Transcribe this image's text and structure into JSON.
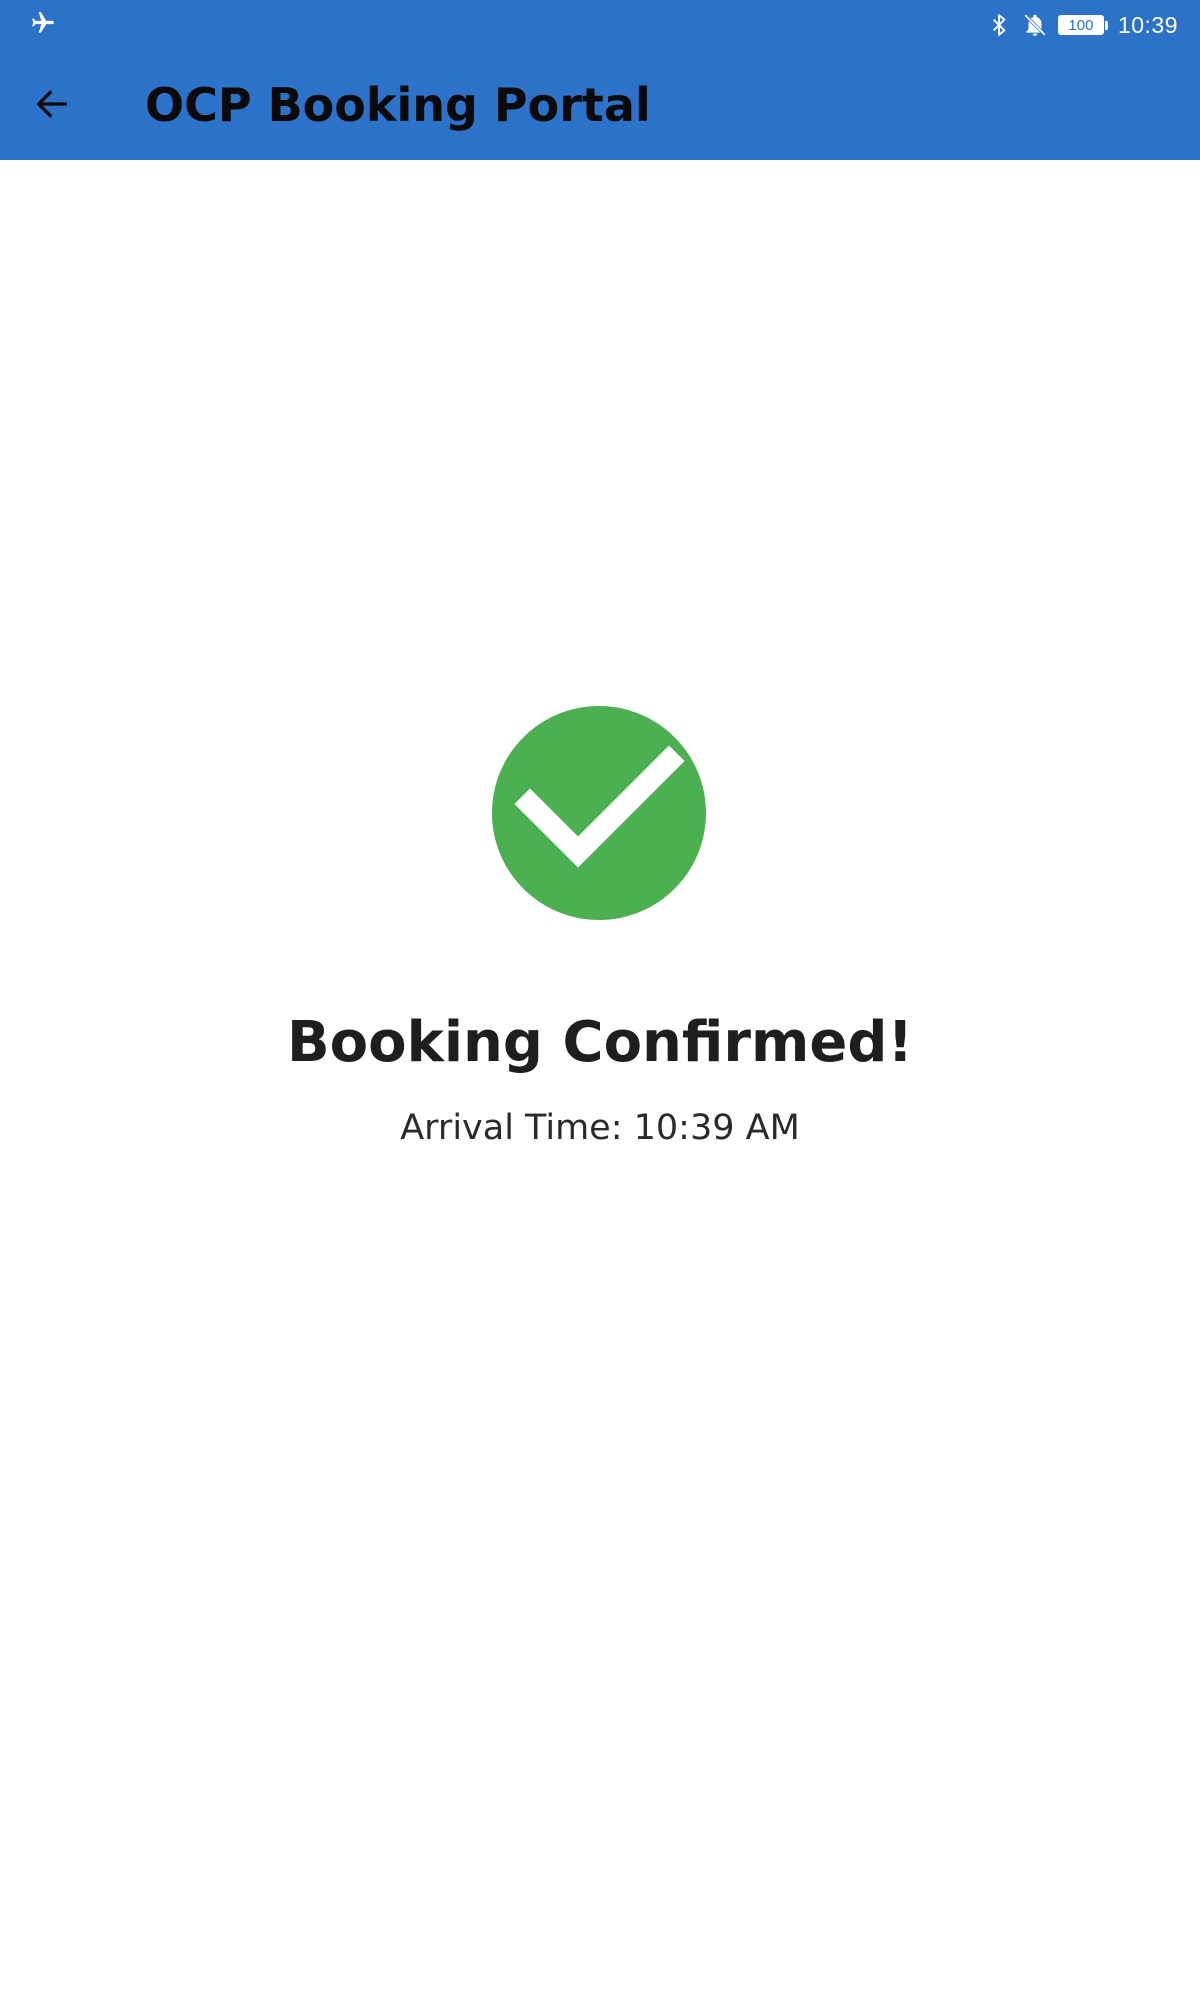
{
  "status_bar": {
    "time": "10:39",
    "battery_level": "100",
    "icons": [
      "airplane-icon",
      "bluetooth-icon",
      "bell-off-icon",
      "battery-icon"
    ]
  },
  "app_bar": {
    "title": "OCP Booking Portal",
    "back_icon": "arrow-left-icon"
  },
  "confirmation": {
    "icon": "check-circle-icon",
    "title": "Booking Confirmed!",
    "arrival_text": "Arrival Time: 10:39 AM"
  },
  "colors": {
    "app_bar": "#2d72c9",
    "success": "#4caf50",
    "background": "#ffffff"
  }
}
